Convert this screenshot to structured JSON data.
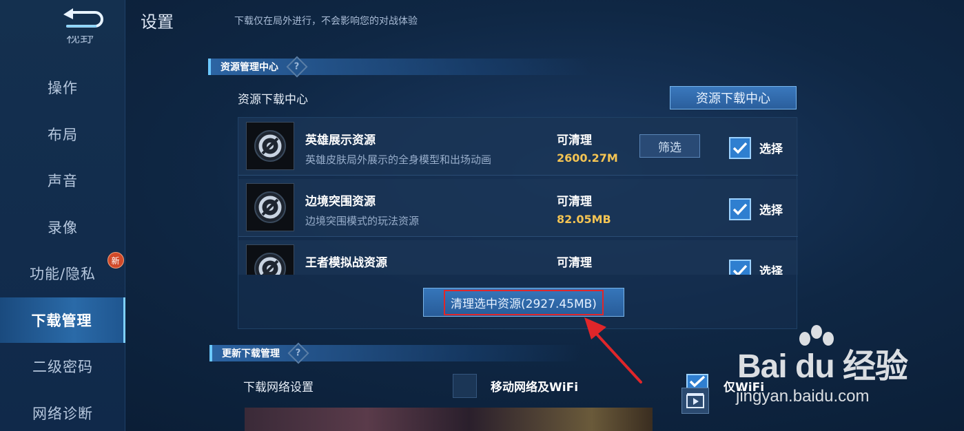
{
  "header": {
    "title": "设置",
    "note": "下载仅在局外进行，不会影响您的对战体验"
  },
  "sidebar": {
    "partial_item": "视野",
    "items": [
      {
        "label": "操作"
      },
      {
        "label": "布局"
      },
      {
        "label": "声音"
      },
      {
        "label": "录像"
      },
      {
        "label": "功能/隐私",
        "badge": "新"
      },
      {
        "label": "下载管理",
        "active": true
      },
      {
        "label": "二级密码"
      },
      {
        "label": "网络诊断"
      }
    ]
  },
  "resource_section": {
    "title": "资源管理中心",
    "help": "?",
    "panel_label": "资源下载中心",
    "download_center_button": "资源下载中心",
    "items": [
      {
        "name": "英雄展示资源",
        "desc": "英雄皮肤局外展示的全身模型和出场动画",
        "status": "可清理",
        "size": "2600.27M",
        "filter": "筛选",
        "checked": true,
        "check_label": "选择"
      },
      {
        "name": "边境突围资源",
        "desc": "边境突围模式的玩法资源",
        "status": "可清理",
        "size": "82.05MB",
        "checked": true,
        "check_label": "选择"
      },
      {
        "name": "王者模拟战资源",
        "desc": "",
        "status": "可清理",
        "size": "",
        "checked": true,
        "check_label": "选择"
      }
    ],
    "clean_button": "清理选中资源(2927.45MB)"
  },
  "update_section": {
    "title": "更新下载管理",
    "help": "?",
    "network_label": "下载网络设置",
    "option_mobile": "移动网络及WiFi",
    "option_wifi": "仅WiFi",
    "option_wifi_checked": true
  },
  "watermark": {
    "logo": "Bai du 经验",
    "sub": "jingyan.baidu.com"
  },
  "colors": {
    "accent": "#2f7fd0",
    "size_text": "#f4c453",
    "annotation_red": "#e0262a"
  }
}
